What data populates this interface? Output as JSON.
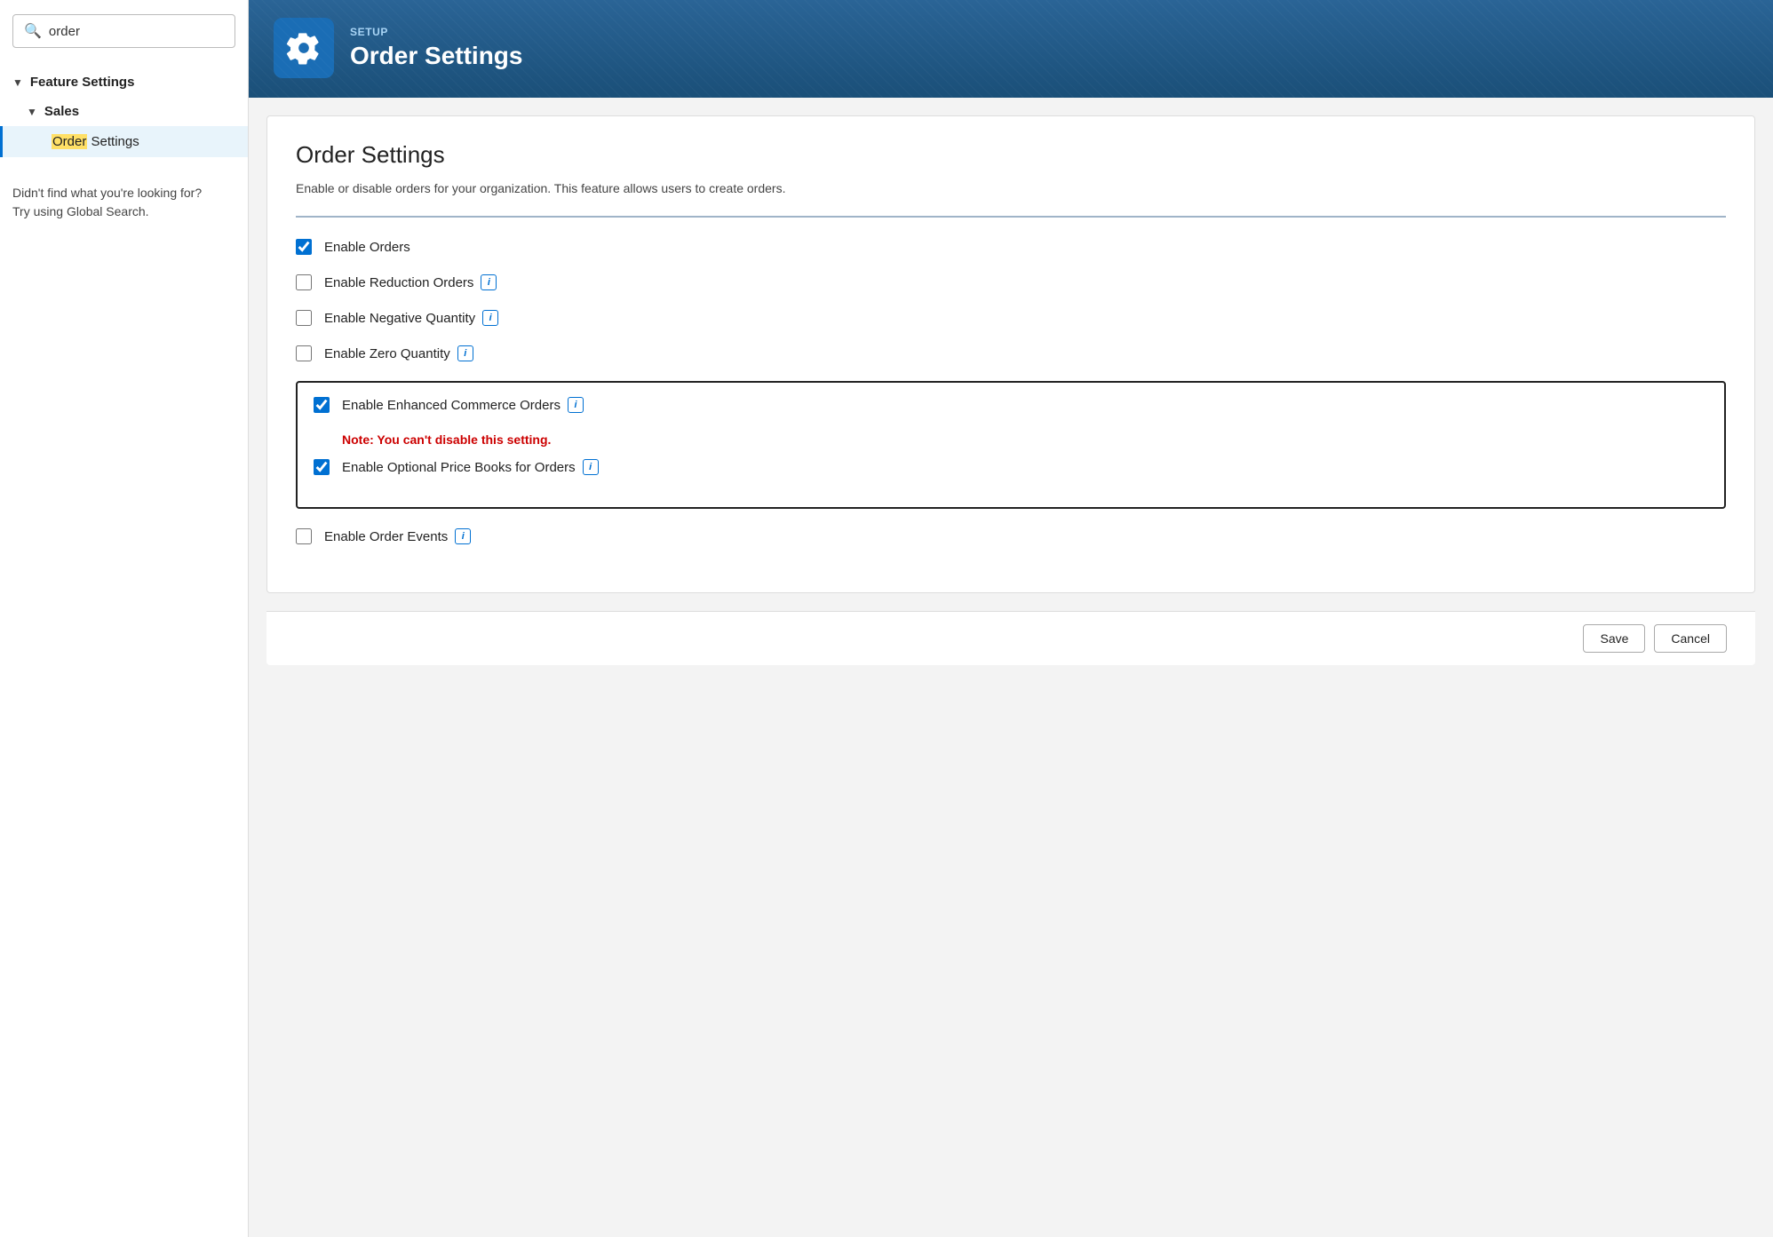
{
  "sidebar": {
    "search_placeholder": "order",
    "search_icon": "search-icon",
    "nav": {
      "feature_settings_label": "Feature Settings",
      "sales_label": "Sales",
      "active_item_prefix": "Order",
      "active_item_suffix": " Settings"
    },
    "hint_text": "Didn't find what you're looking for?\nTry using Global Search."
  },
  "header": {
    "setup_label": "SETUP",
    "page_title": "Order Settings",
    "icon_label": "gear-icon"
  },
  "content": {
    "title": "Order Settings",
    "description": "Enable or disable orders for your organization. This feature allows users to create orders.",
    "checkboxes": [
      {
        "id": "enable-orders",
        "label": "Enable Orders",
        "checked": true,
        "has_info": false
      },
      {
        "id": "enable-reduction-orders",
        "label": "Enable Reduction Orders",
        "checked": false,
        "has_info": true
      },
      {
        "id": "enable-negative-quantity",
        "label": "Enable Negative Quantity",
        "checked": false,
        "has_info": true
      },
      {
        "id": "enable-zero-quantity",
        "label": "Enable Zero Quantity",
        "checked": false,
        "has_info": true
      }
    ],
    "enhanced_box": {
      "checkbox_id": "enable-enhanced-commerce",
      "label": "Enable Enhanced Commerce Orders",
      "checked": true,
      "has_info": true,
      "note": "Note: You can't disable this setting.",
      "sub_checkbox_id": "enable-optional-price-books",
      "sub_label": "Enable Optional Price Books for Orders",
      "sub_checked": true,
      "sub_has_info": true
    },
    "bottom_checkboxes": [
      {
        "id": "enable-order-events",
        "label": "Enable Order Events",
        "checked": false,
        "has_info": true
      }
    ],
    "footer": {
      "save_label": "Save",
      "cancel_label": "Cancel"
    }
  }
}
